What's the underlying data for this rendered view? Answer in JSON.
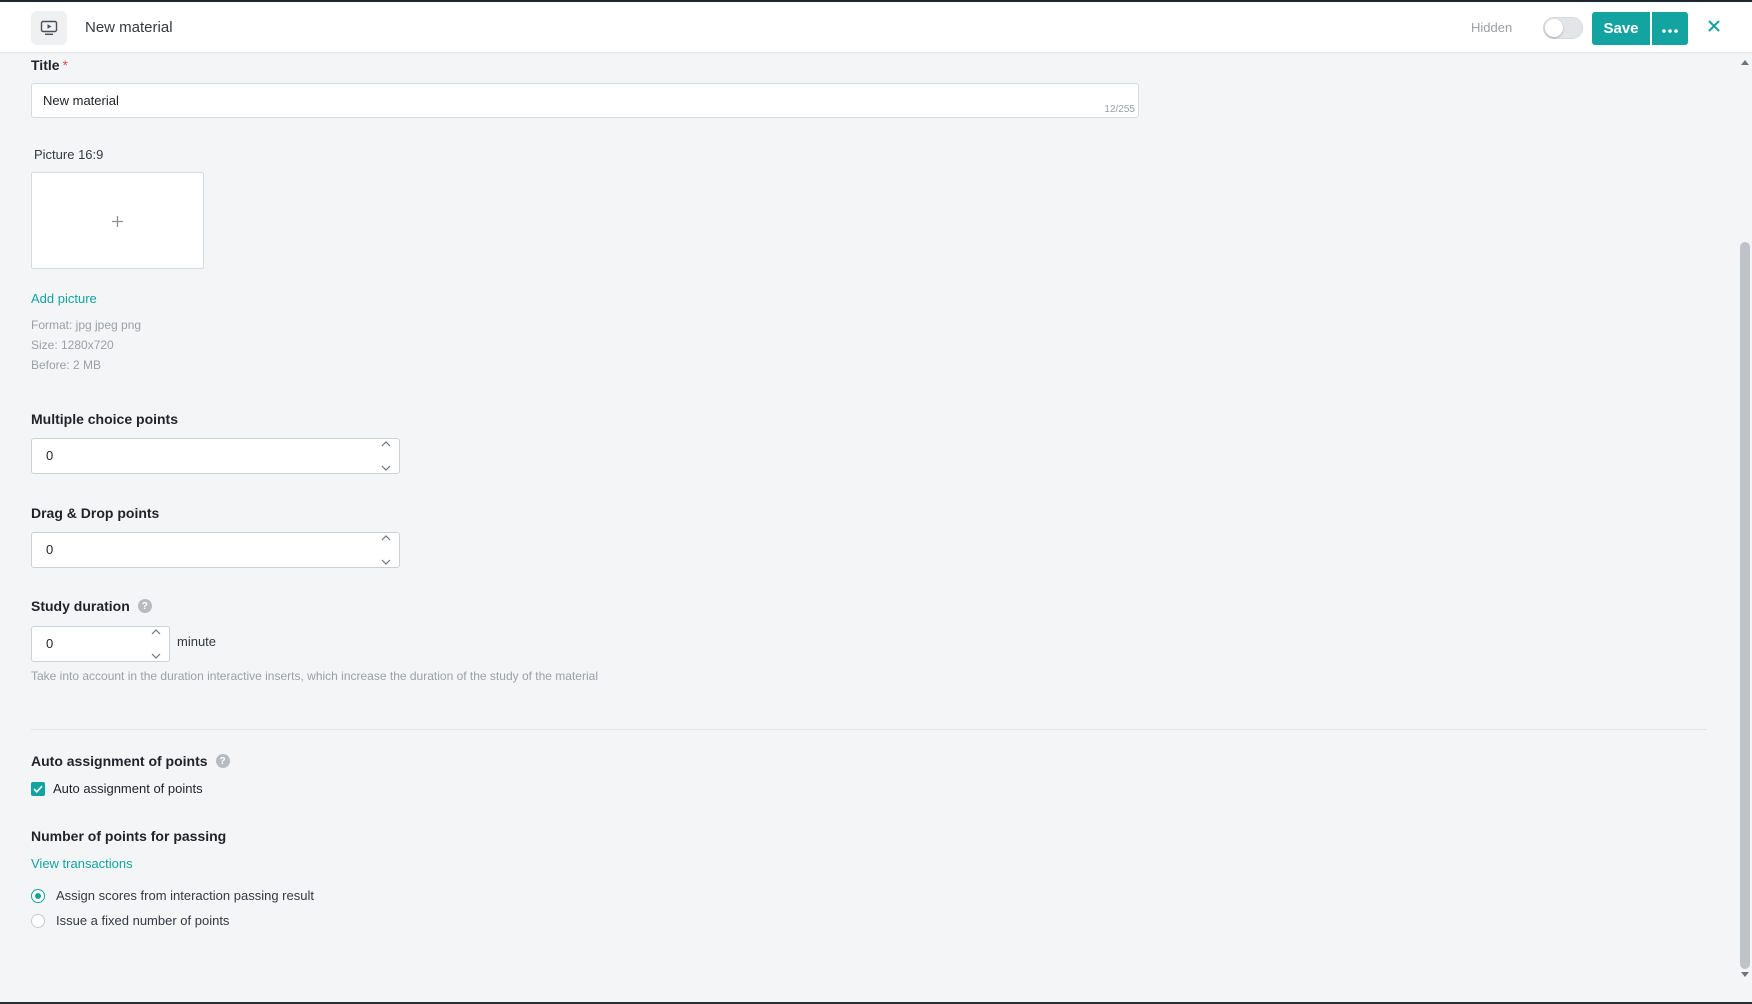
{
  "header": {
    "title": "New material",
    "hidden_label": "Hidden",
    "save_label": "Save"
  },
  "form": {
    "title_label": "Title",
    "required_mark": "*",
    "title_value": "New material",
    "title_counter": "12/255",
    "picture_label": "Picture 16:9",
    "add_picture": "Add picture",
    "format_hint": "Format: jpg  jpeg  png",
    "size_hint": "Size: 1280x720",
    "before_hint": "Before: 2 MB",
    "multiple_choice_label": "Multiple choice points",
    "multiple_choice_value": "0",
    "drag_drop_label": "Drag & Drop points",
    "drag_drop_value": "0",
    "study_duration_label": "Study duration",
    "study_duration_value": "0",
    "study_duration_unit": "minute",
    "study_duration_desc": "Take into account in the duration interactive inserts, which increase the duration of the study of the material",
    "auto_assign_title": "Auto assignment of points",
    "auto_assign_checkbox": "Auto assignment of points",
    "auto_assign_checked": true,
    "passing_points_title": "Number of points for passing",
    "view_transactions": "View transactions",
    "radio_options": [
      {
        "label": "Assign scores from interaction passing result",
        "selected": true
      },
      {
        "label": "Issue a fixed number of points",
        "selected": false
      }
    ]
  },
  "icons": {
    "material": "video-material-icon",
    "more": "more-dots-icon",
    "close": "close-icon",
    "help": "help-question-icon",
    "plus": "plus-icon"
  },
  "colors": {
    "accent": "#13a3a0",
    "required": "#e54b4b",
    "background": "#f4f5f7"
  }
}
